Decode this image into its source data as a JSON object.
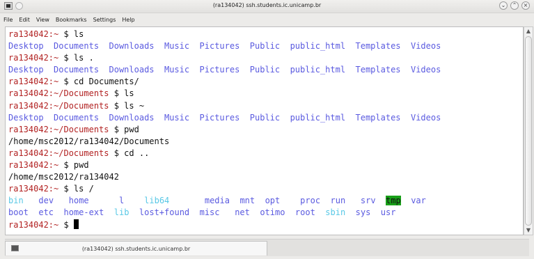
{
  "window": {
    "title": "(ra134042) ssh.students.ic.unicamp.br"
  },
  "menu": [
    "File",
    "Edit",
    "View",
    "Bookmarks",
    "Settings",
    "Help"
  ],
  "terminal": {
    "lines": [
      {
        "segments": [
          {
            "text": "ra134042:~ ",
            "cls": "prompt"
          },
          {
            "text": "$ ls"
          }
        ]
      },
      {
        "segments": [
          {
            "text": "Desktop  Documents  Downloads  Music  Pictures  Public  public_html  Templates  Videos",
            "cls": "dir"
          }
        ]
      },
      {
        "segments": [
          {
            "text": "ra134042:~ ",
            "cls": "prompt"
          },
          {
            "text": "$ ls ."
          }
        ]
      },
      {
        "segments": [
          {
            "text": "Desktop  Documents  Downloads  Music  Pictures  Public  public_html  Templates  Videos",
            "cls": "dir"
          }
        ]
      },
      {
        "segments": [
          {
            "text": "ra134042:~ ",
            "cls": "prompt"
          },
          {
            "text": "$ cd Documents/"
          }
        ]
      },
      {
        "segments": [
          {
            "text": "ra134042:~/Documents ",
            "cls": "prompt"
          },
          {
            "text": "$ ls"
          }
        ]
      },
      {
        "segments": [
          {
            "text": "ra134042:~/Documents ",
            "cls": "prompt"
          },
          {
            "text": "$ ls ~"
          }
        ]
      },
      {
        "segments": [
          {
            "text": "Desktop  Documents  Downloads  Music  Pictures  Public  public_html  Templates  Videos",
            "cls": "dir"
          }
        ]
      },
      {
        "segments": [
          {
            "text": "ra134042:~/Documents ",
            "cls": "prompt"
          },
          {
            "text": "$ pwd"
          }
        ]
      },
      {
        "segments": [
          {
            "text": "/home/msc2012/ra134042/Documents"
          }
        ]
      },
      {
        "segments": [
          {
            "text": "ra134042:~/Documents ",
            "cls": "prompt"
          },
          {
            "text": "$ cd .."
          }
        ]
      },
      {
        "segments": [
          {
            "text": "ra134042:~ ",
            "cls": "prompt"
          },
          {
            "text": "$ pwd"
          }
        ]
      },
      {
        "segments": [
          {
            "text": "/home/msc2012/ra134042"
          }
        ]
      },
      {
        "segments": [
          {
            "text": "ra134042:~ ",
            "cls": "prompt"
          },
          {
            "text": "$ ls /"
          }
        ]
      },
      {
        "segments": [
          {
            "text": "bin",
            "cls": "link"
          },
          {
            "text": "   "
          },
          {
            "text": "dev",
            "cls": "dir"
          },
          {
            "text": "   "
          },
          {
            "text": "home",
            "cls": "dir"
          },
          {
            "text": "      "
          },
          {
            "text": "l",
            "cls": "dir"
          },
          {
            "text": "    "
          },
          {
            "text": "lib64",
            "cls": "link"
          },
          {
            "text": "       "
          },
          {
            "text": "media",
            "cls": "dir"
          },
          {
            "text": "  "
          },
          {
            "text": "mnt",
            "cls": "dir"
          },
          {
            "text": "  "
          },
          {
            "text": "opt",
            "cls": "dir"
          },
          {
            "text": "    "
          },
          {
            "text": "proc",
            "cls": "dir"
          },
          {
            "text": "  "
          },
          {
            "text": "run",
            "cls": "dir"
          },
          {
            "text": "   "
          },
          {
            "text": "srv",
            "cls": "dir"
          },
          {
            "text": "  "
          },
          {
            "text": "tmp",
            "cls": "stky"
          },
          {
            "text": "  "
          },
          {
            "text": "var",
            "cls": "dir"
          }
        ]
      },
      {
        "segments": [
          {
            "text": "boot",
            "cls": "dir"
          },
          {
            "text": "  "
          },
          {
            "text": "etc",
            "cls": "dir"
          },
          {
            "text": "  "
          },
          {
            "text": "home-ext",
            "cls": "dir"
          },
          {
            "text": "  "
          },
          {
            "text": "lib",
            "cls": "link"
          },
          {
            "text": "  "
          },
          {
            "text": "lost+found",
            "cls": "dir"
          },
          {
            "text": "  "
          },
          {
            "text": "misc",
            "cls": "dir"
          },
          {
            "text": "   "
          },
          {
            "text": "net",
            "cls": "dir"
          },
          {
            "text": "  "
          },
          {
            "text": "otimo",
            "cls": "dir"
          },
          {
            "text": "  "
          },
          {
            "text": "root",
            "cls": "dir"
          },
          {
            "text": "  "
          },
          {
            "text": "sbin",
            "cls": "link"
          },
          {
            "text": "  "
          },
          {
            "text": "sys",
            "cls": "dir"
          },
          {
            "text": "  "
          },
          {
            "text": "usr",
            "cls": "dir"
          }
        ]
      },
      {
        "segments": [
          {
            "text": "ra134042:~ ",
            "cls": "prompt"
          },
          {
            "text": "$ "
          }
        ],
        "cursor": true
      }
    ]
  },
  "tab": {
    "label": "(ra134042) ssh.students.ic.unicamp.br"
  },
  "colors": {
    "prompt": "#b22222",
    "dir": "#5a5ae0",
    "link": "#58c8e6",
    "sticky_bg": "#18a018"
  }
}
